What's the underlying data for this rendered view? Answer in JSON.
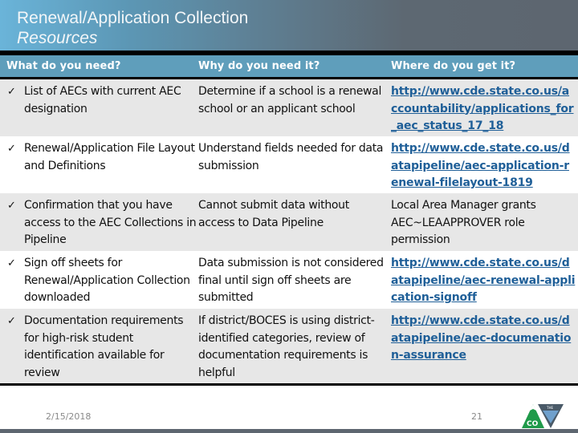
{
  "slide": {
    "title_line1": "Renewal/Application Collection",
    "title_line2": "Resources",
    "footer_date": "2/15/2018",
    "page_number": "21",
    "logo": "cde-colorado-logo",
    "colors": {
      "title_gradient_start": "#6ab4d9",
      "title_gradient_end": "#5d6670",
      "header_blue": "#5f9ebb",
      "row_alt": "#e7e7e7",
      "link": "#1f5f98"
    }
  },
  "table": {
    "headers": [
      "What do you need?",
      "Why do you need it?",
      "Where do you get it?"
    ],
    "check_icon": "✓",
    "rows": [
      {
        "need": "List of AECs with current AEC designation",
        "why": "Determine if a school is a renewal school or an applicant school",
        "where": "http://www.cde.state.co.us/accountability/applications_for_aec_status_17_18",
        "where_is_link": true
      },
      {
        "need": "Renewal/Application File Layout and Definitions",
        "why": "Understand fields needed for data submission",
        "where": "http://www.cde.state.co.us/datapipeline/aec-application-renewal-filelayout-1819",
        "where_is_link": true
      },
      {
        "need": "Confirmation that you have access to the AEC Collections in Pipeline",
        "why": "Cannot submit data without access to Data Pipeline",
        "where": "Local Area Manager grants AEC~LEAAPPROVER role permission",
        "where_is_link": false
      },
      {
        "need": "Sign off sheets for Renewal/Application Collection downloaded",
        "why": "Data submission is not considered final until sign off sheets are submitted",
        "where": "http://www.cde.state.co.us/datapipeline/aec-renewal-application-signoff",
        "where_is_link": true
      },
      {
        "need": "Documentation requirements for high-risk student identification available for review",
        "why": "If district/BOCES is using district-identified categories, review of documentation requirements is helpful",
        "where": "http://www.cde.state.co.us/datapipeline/aec-documenation-assurance",
        "where_is_link": true
      }
    ]
  }
}
